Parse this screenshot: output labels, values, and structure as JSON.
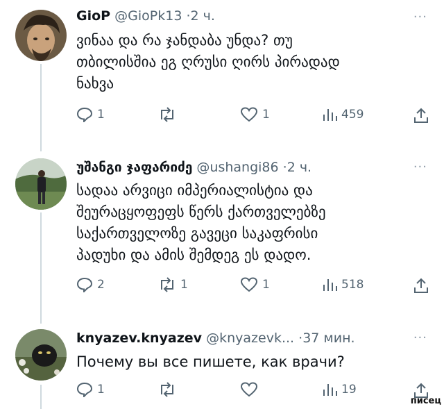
{
  "tweets": [
    {
      "name": "GioP",
      "handle": "@GioPk13",
      "time": "2 ч.",
      "more": "···",
      "lines": [
        "ვინაა და რა ჯანდაბა უნდა? თუ",
        "თბილისშია ეგ ღრუსი ღირს პირადად",
        "ნახვა"
      ],
      "replies": "1",
      "retweets": "",
      "likes": "1",
      "views": "459"
    },
    {
      "name": "უშანგი ჯაფარიძე",
      "handle": "@ushangi86",
      "time": "2 ч.",
      "more": "···",
      "lines": [
        "სადაა არვიცი იმპერიალისტია და",
        "შეურაცყოფეფს წერს ქართველებზე",
        "საქართველოზე გავეცი საკაფრისი",
        "პადუხი და ამის შემდეგ ეს დადო."
      ],
      "replies": "2",
      "retweets": "1",
      "likes": "1",
      "views": "518"
    },
    {
      "name": "knyazev.knyazev",
      "handle": "@knyazevk...",
      "time": "37 мин.",
      "more": "···",
      "lines": [
        "Почему вы все пишете, как врачи?"
      ],
      "replies": "1",
      "retweets": "",
      "likes": "",
      "views": "19"
    }
  ],
  "watermark": "писец"
}
